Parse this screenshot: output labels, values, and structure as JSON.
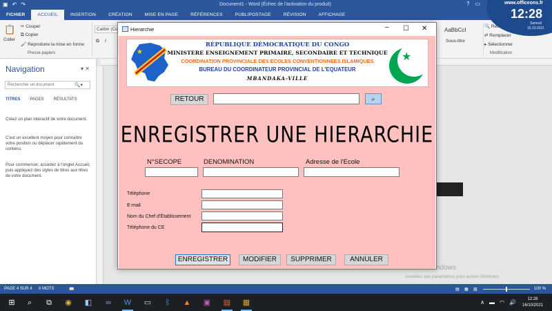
{
  "word": {
    "qat_icons": [
      "save-icon",
      "undo-icon",
      "redo-icon"
    ],
    "doc_title": "Document1 - Word (Échec de l'activation du produit)",
    "tabs": [
      "FICHIER",
      "ACCUEIL",
      "INSERTION",
      "CRÉATION",
      "MISE EN PAGE",
      "RÉFÉRENCES",
      "PUBLIPOSTAGE",
      "RÉVISION",
      "AFFICHAGE"
    ],
    "active_tab": "ACCUEIL",
    "ribbon": {
      "paste_label": "Coller",
      "cut_label": "Couper",
      "copy_label": "Copier",
      "format_painter_label": "Reproduire la mise en forme",
      "clipboard_group": "Presse-papiers",
      "font_value": "Calibri (Co",
      "style_preview": "AaBbCcI",
      "style_name": "Sous-titre",
      "find_label": "Recher",
      "replace_label": "Remplacer",
      "select_label": "Sélectionner",
      "editing_group": "Modification"
    },
    "navigation": {
      "title": "Navigation",
      "close_glyph": "▾ ✕",
      "search_placeholder": "Rechercher un document",
      "tabs": [
        "TITRES",
        "PAGES",
        "RÉSULTATS"
      ],
      "para1": "Créez un plan interactif de votre document.",
      "para2": "C'est un excellent moyen pour connaître votre position ou déplacer rapidement du contenu.",
      "para3": "Pour commencer, accédez à l'onglet Accueil, puis appliquez des styles de titres aux titres de votre document."
    },
    "status": {
      "page": "PAGE 4 SUR 4",
      "words": "0 MOTS",
      "zoom": "100 %"
    },
    "activate_title": "Activer Windows",
    "activate_sub": "Accédez aux paramètres pour activer Windows."
  },
  "clock_overlay": {
    "site": "www.officeons.fr",
    "time": "12:28",
    "day": "Samedi",
    "date": "16.10.2021"
  },
  "taskbar": {
    "icons": [
      "windows-start-icon",
      "search-icon",
      "task-view-icon",
      "chrome-icon",
      "box-app-icon",
      "link-app-icon",
      "word-icon",
      "terminal-icon",
      "bluetooth-icon",
      "vlc-icon",
      "winrar-icon",
      "app-window-icon"
    ],
    "time": "12:28",
    "date": "16/10/2021"
  },
  "dialog": {
    "title": "Hierarchie",
    "banner": {
      "line1": "RÉPUBLIQUE DÉMOCRATIQUE DU CONGO",
      "line2": "MINISTERE ENSEIGNEMENT PRIMAIRE, SECONDAIRE ET TECHNIQUE",
      "line3": "COORDINATION PROVINCIALE DES ECOLES CONVENTIONNEES ISLAMIQUES",
      "line4": "BUREAU DU COORDINATEUR PROVINCIAL DE L'EQUATEUR",
      "line5": "MBANDAKA-VILLE"
    },
    "colors": {
      "background": "#ffc0c0",
      "crescent": "#00a651",
      "banner_blue": "#1f3fa8",
      "banner_orange": "#e86a1a"
    },
    "retour_label": "RETOUR",
    "search_value": "",
    "form_title": "ENREGISTRER UNE HIERARCHIE",
    "fields_top": [
      {
        "label": "N°SECOPE",
        "value": ""
      },
      {
        "label": "DENOMINATION",
        "value": ""
      },
      {
        "label": "Adresse de l'Ecole",
        "value": ""
      }
    ],
    "fields_left": [
      {
        "label": "Téléphone",
        "value": ""
      },
      {
        "label": "E-mail",
        "value": ""
      },
      {
        "label": "Nom du Chef d'Établissement",
        "value": ""
      },
      {
        "label": "Téléphone du CE",
        "value": ""
      }
    ],
    "buttons": {
      "save": "ENREGISTRER",
      "modify": "MODIFIER",
      "delete": "SUPPRIMER",
      "cancel": "ANNULER"
    }
  }
}
